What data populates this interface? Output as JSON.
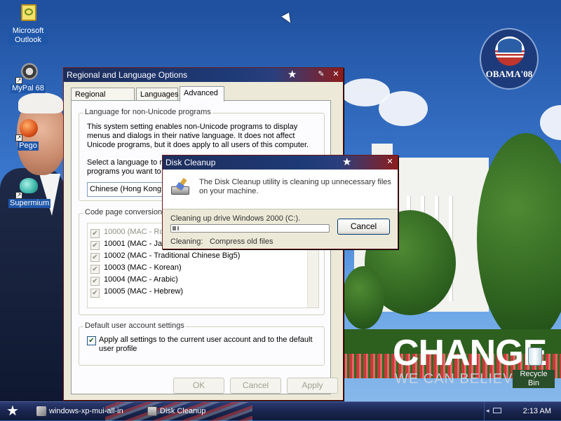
{
  "desktop": {
    "icons": [
      {
        "label": "Microsoft Outlook",
        "icon": "outlook-icon"
      },
      {
        "label": "MyPal 68",
        "icon": "mypal-icon"
      },
      {
        "label": "Pego",
        "icon": "pego-icon"
      },
      {
        "label": "Supermium",
        "icon": "supermium-icon"
      },
      {
        "label": "Recycle Bin",
        "icon": "recycle-bin-icon"
      }
    ],
    "wallpaper": {
      "headline": "CHANGE",
      "tagline": "WE CAN BELIEVE IN",
      "logo_text": "OBAMA'08"
    }
  },
  "regional_window": {
    "title": "Regional and Language Options",
    "tabs": [
      "Regional Options",
      "Languages",
      "Advanced"
    ],
    "active_tab": "Advanced",
    "group_unicode": {
      "legend": "Language for non-Unicode programs",
      "description": "This system setting enables non-Unicode programs to display menus and dialogs in their native language. It does not affect Unicode programs, but it does apply to all users of this computer.",
      "select_prompt_line1": "Select a language to m",
      "select_prompt_line2": "programs you want to u",
      "selected_language": "Chinese (Hong Kong S"
    },
    "group_codepage": {
      "legend": "Code page conversion t",
      "items": [
        {
          "label": "10000 (MAC - Ro",
          "enabled": false
        },
        {
          "label": "10001 (MAC - Jap",
          "enabled": true
        },
        {
          "label": "10002 (MAC - Traditional Chinese Big5)",
          "enabled": true
        },
        {
          "label": "10003 (MAC - Korean)",
          "enabled": true
        },
        {
          "label": "10004 (MAC - Arabic)",
          "enabled": true
        },
        {
          "label": "10005 (MAC - Hebrew)",
          "enabled": true
        }
      ]
    },
    "group_default_user": {
      "legend": "Default user account settings",
      "checkbox_label": "Apply all settings to the current user account and to the default user profile",
      "checked": true
    },
    "buttons": {
      "ok": "OK",
      "cancel": "Cancel",
      "apply": "Apply"
    }
  },
  "cleanup_window": {
    "title": "Disk Cleanup",
    "message": "The Disk Cleanup utility is cleaning up unnecessary files on your machine.",
    "drive_status": "Cleaning up drive Windows 2000 (C:).",
    "progress": 0.04,
    "cleaning_label": "Cleaning:",
    "cleaning_item": "Compress old files",
    "cancel": "Cancel"
  },
  "taskbar": {
    "tasks": [
      {
        "label": "windows-xp-mui-all-in",
        "icon": "install-icon"
      },
      {
        "label": "Disk Cleanup",
        "icon": "disk-cleanup-icon"
      }
    ],
    "clock": "2:13 AM"
  }
}
